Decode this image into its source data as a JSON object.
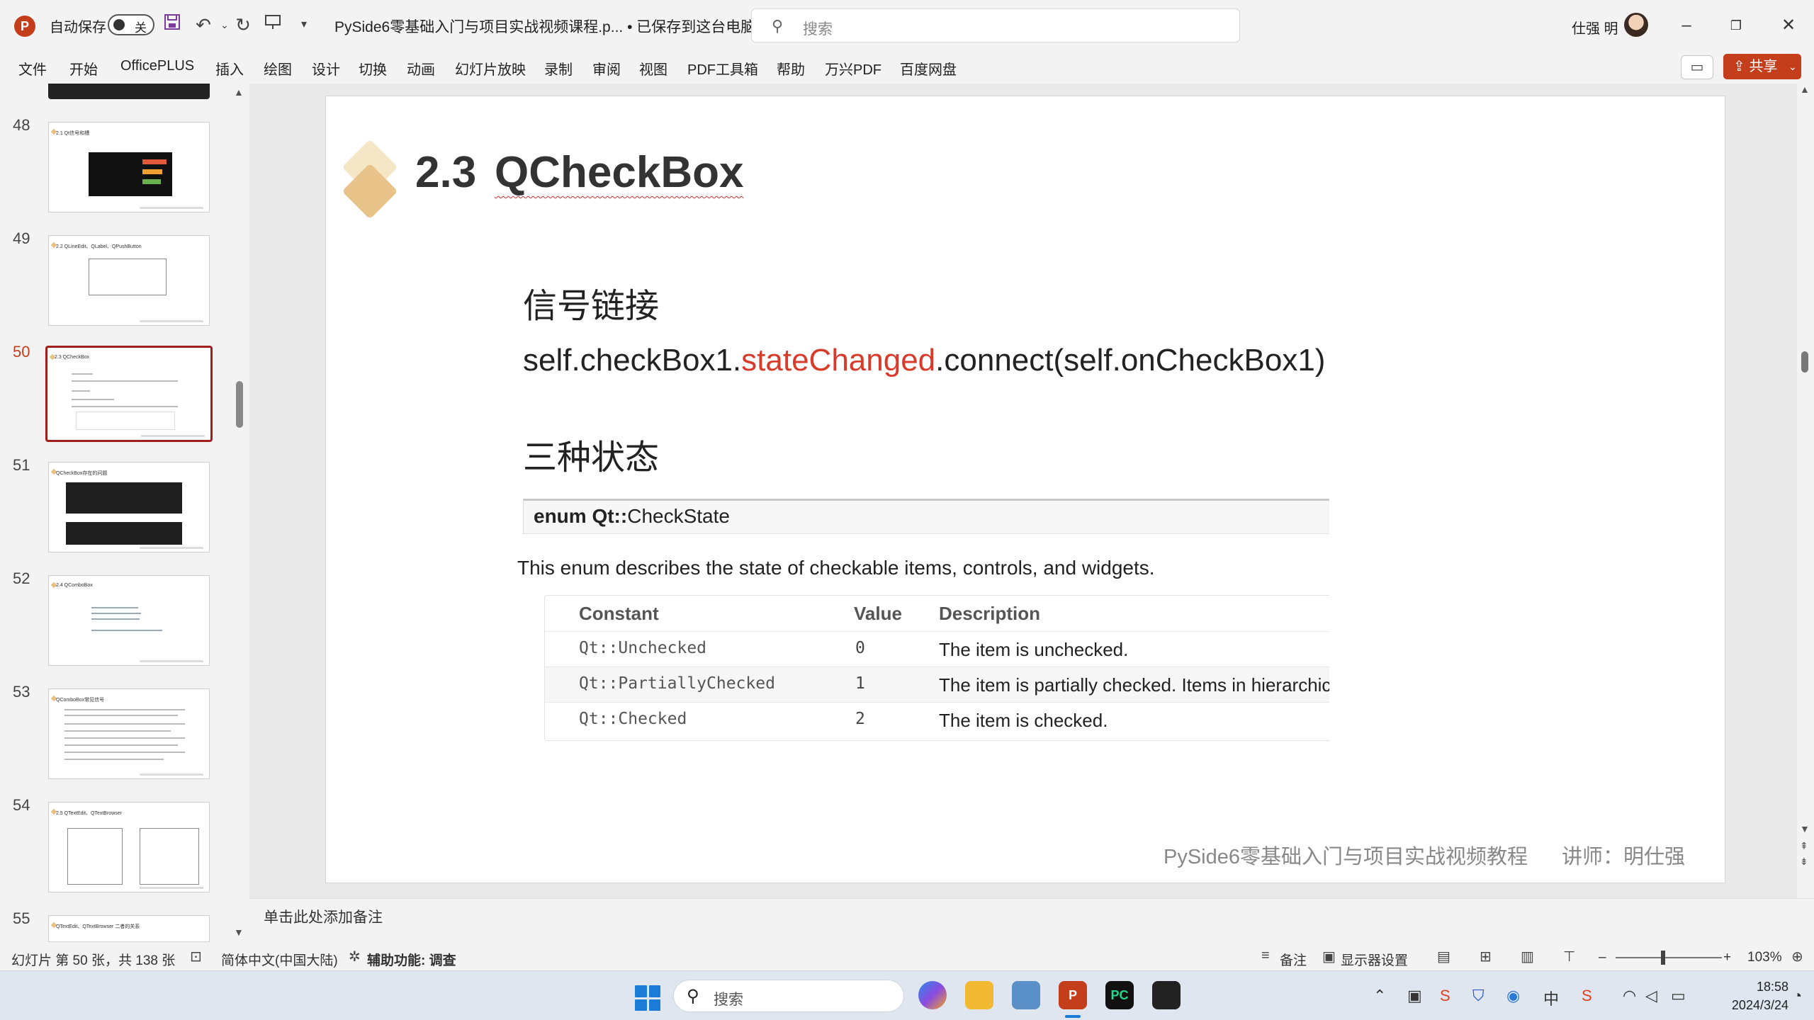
{
  "titlebar": {
    "autosave_label": "自动保存",
    "autosave_state": "关",
    "doc_title": "PySide6零基础入门与项目实战视频课程.p... • 已保存到这台电脑 ⌵",
    "search_placeholder": "搜索",
    "user_name": "仕强 明",
    "icons": [
      "powerpoint-logo",
      "save-icon",
      "undo-icon",
      "redo-icon",
      "present-icon",
      "customize-icon"
    ]
  },
  "ribbon": {
    "tabs": [
      "文件",
      "开始",
      "OfficePLUS",
      "插入",
      "绘图",
      "设计",
      "切换",
      "动画",
      "幻灯片放映",
      "录制",
      "审阅",
      "视图",
      "PDF工具箱",
      "帮助",
      "万兴PDF",
      "百度网盘"
    ],
    "share_label": "共享"
  },
  "thumbnails": [
    {
      "num": "48",
      "title": "2.1 Qt信号和槽"
    },
    {
      "num": "49",
      "title": "2.2 QLineEdit、QLabel、QPushButton"
    },
    {
      "num": "50",
      "title": "2.3 QCheckBox",
      "active": true
    },
    {
      "num": "51",
      "title": "QCheckBox存在的问题"
    },
    {
      "num": "52",
      "title": "2.4 QComboBox"
    },
    {
      "num": "53",
      "title": "QComboBox常见信号"
    },
    {
      "num": "54",
      "title": "2.5 QTextEdit、QTextBrowser"
    },
    {
      "num": "55",
      "title": "QTextEdit、QTextBrowser 二者的关系"
    }
  ],
  "slide": {
    "title_num": "2.3",
    "title_text": "QCheckBox",
    "section1": "信号链接",
    "code_prefix": "self.checkBox1.",
    "code_signal": "stateChanged",
    "code_suffix": ".connect(self.onCheckBox1)",
    "section2": "三种状态",
    "enum_keyword": "enum Qt::",
    "enum_name": "CheckState",
    "enum_desc": "This enum describes the state of checkable items, controls, and widgets.",
    "table_headers": [
      "Constant",
      "Value",
      "Description"
    ],
    "table_rows": [
      {
        "constant": "Qt::Unchecked",
        "value": "0",
        "description": "The item is unchecked."
      },
      {
        "constant": "Qt::PartiallyChecked",
        "value": "1",
        "description": "The item is partially checked. Items in hierarchical"
      },
      {
        "constant": "Qt::Checked",
        "value": "2",
        "description": "The item is checked."
      }
    ],
    "footer_course": "PySide6零基础入门与项目实战视频教程",
    "footer_teacher": "讲师：明仕强"
  },
  "notes_placeholder": "单击此处添加备注",
  "statusbar": {
    "slide_info": "幻灯片 第 50 张，共 138 张",
    "language": "简体中文(中国大陆)",
    "accessibility": "辅助功能: 调查",
    "notes_label": "备注",
    "display_settings": "显示器设置",
    "zoom": "103%"
  },
  "taskbar": {
    "search_placeholder": "搜索",
    "time": "18:58",
    "date": "2024/3/24",
    "ime": "中"
  },
  "colors": {
    "accent": "#c43e1c",
    "active_thumb_border": "#a01f1a",
    "signal_red": "#d93b2b"
  }
}
